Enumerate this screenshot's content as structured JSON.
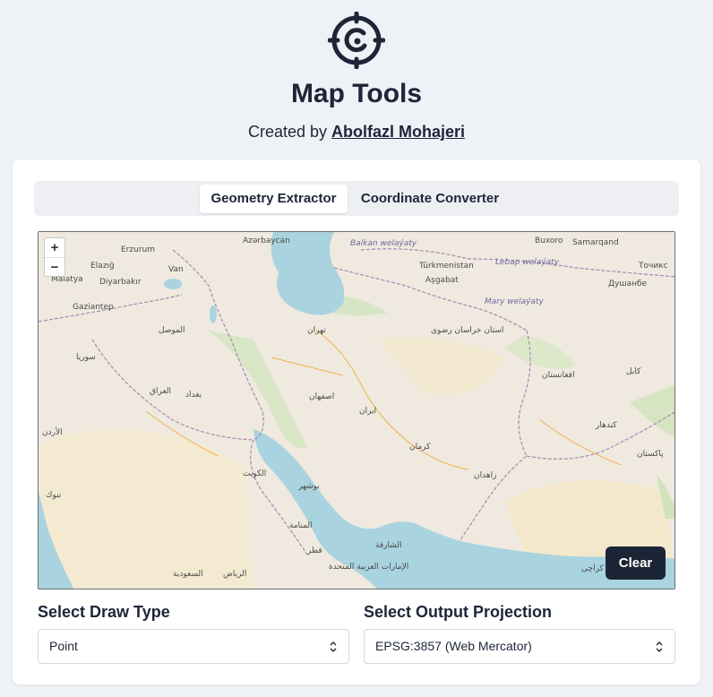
{
  "header": {
    "logo_icon": "crosshair-logo-icon",
    "title": "Map Tools",
    "created_by_prefix": "Created by",
    "author": "Abolfazl Mohajeri"
  },
  "tabs": [
    {
      "label": "Geometry Extractor",
      "active": true
    },
    {
      "label": "Coordinate Converter",
      "active": false
    }
  ],
  "map": {
    "zoom_in": "+",
    "zoom_out": "−",
    "clear_label": "Clear",
    "place_labels": {
      "azerbaycan": "Azərbaycan",
      "erzurum": "Erzurum",
      "van": "Van",
      "elazig": "Elazığ",
      "malatya": "Malatya",
      "diyarbakir": "Diyarbakır",
      "gaziantep": "Gaziantep",
      "balkan": "Balkan welaýaty",
      "turkmenistan": "Türkmenistan",
      "ashgabat": "Aşgabat",
      "lebap": "Lebap welaýaty",
      "mary": "Mary welaýaty",
      "buxoro": "Buxoro",
      "samarqand": "Samarqand",
      "dushanbe": "Душанбе",
      "tochik": "Точикс",
      "tehran": "تهران",
      "iran": "ایران",
      "esfahan": "اصفهان",
      "kerman": "کرمان",
      "zahedan": "زاهدان",
      "bushehr": "بوشهر",
      "iraq": "العراق",
      "baghdad": "بغداد",
      "kuwait": "الكويت",
      "afghanistan": "افغانستان",
      "kabul": "کابل",
      "kandahar": "کندهار",
      "pakistan": "پاکستان",
      "syria": "سوريا",
      "mosul": "الموصل",
      "tabuk": "تبوك",
      "riyadh": "الرياض",
      "saudi": "السعودية",
      "uae": "الإمارات العربية المتحدة",
      "sharjah": "الشارقة",
      "manama": "المنامة",
      "qatar": "قطر",
      "mashhad_region": "استان خراسان رضوی",
      "karachi": "کراچی",
      "jordan": "الأردن"
    }
  },
  "draw_type": {
    "label": "Select Draw Type",
    "value": "Point"
  },
  "projection": {
    "label": "Select Output Projection",
    "value": "EPSG:3857 (Web Mercator)"
  }
}
